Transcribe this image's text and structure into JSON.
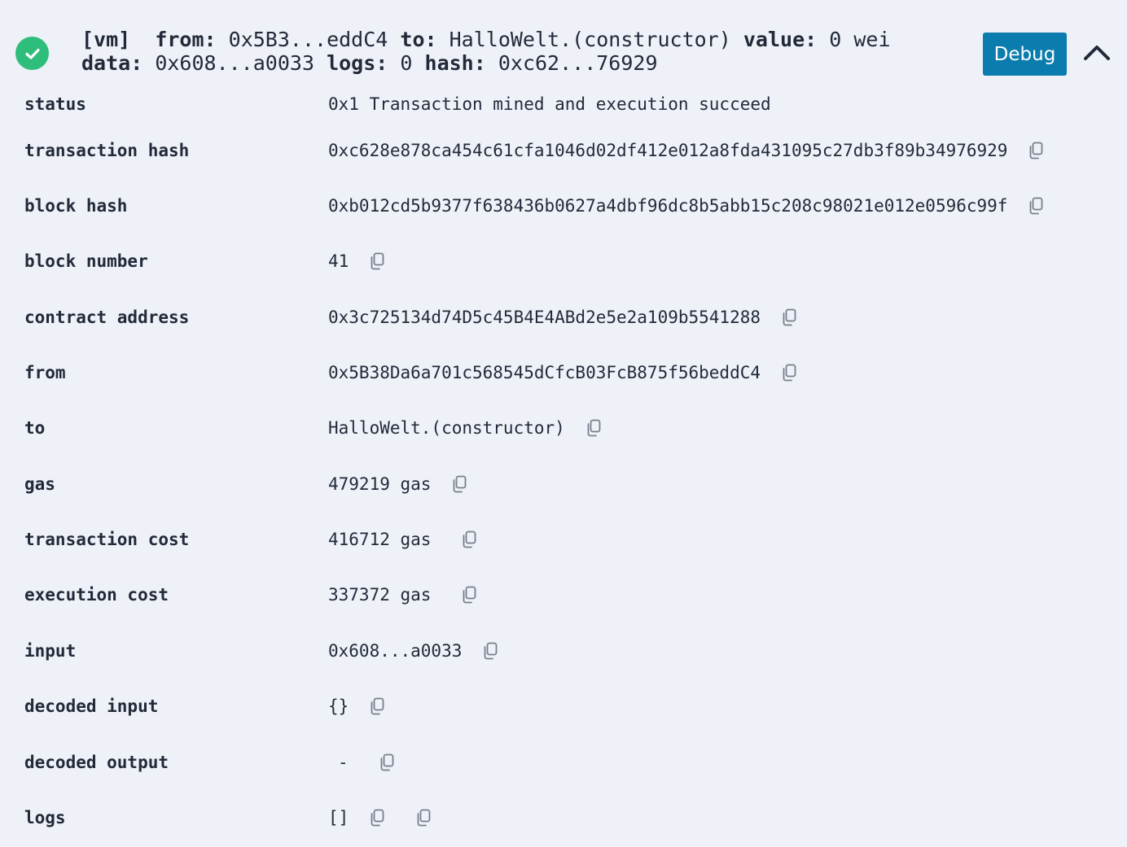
{
  "header": {
    "vm_tag": "[vm]",
    "from_label": "from:",
    "from_value": "0x5B3...eddC4",
    "to_label": "to:",
    "to_value": "HalloWelt.(constructor)",
    "value_label": "value:",
    "value_value": "0 wei",
    "data_label": "data:",
    "data_value": "0x608...a0033",
    "logs_label": "logs:",
    "logs_value": "0",
    "hash_label": "hash:",
    "hash_value": "0xc62...76929",
    "debug_label": "Debug",
    "status_color": "#2fbd7c",
    "debug_color": "#0a7cad"
  },
  "details": {
    "status": {
      "label": "status",
      "value": "0x1 Transaction mined and execution succeed"
    },
    "transaction_hash": {
      "label": "transaction hash",
      "value": "0xc628e878ca454c61cfa1046d02df412e012a8fda431095c27db3f89b34976929"
    },
    "block_hash": {
      "label": "block hash",
      "value": "0xb012cd5b9377f638436b0627a4dbf96dc8b5abb15c208c98021e012e0596c99f"
    },
    "block_number": {
      "label": "block number",
      "value": "41"
    },
    "contract_address": {
      "label": "contract address",
      "value": "0x3c725134d74D5c45B4E4ABd2e5e2a109b5541288"
    },
    "from": {
      "label": "from",
      "value": "0x5B38Da6a701c568545dCfcB03FcB875f56beddC4"
    },
    "to": {
      "label": "to",
      "value": "HalloWelt.(constructor)"
    },
    "gas": {
      "label": "gas",
      "value": "479219 gas"
    },
    "transaction_cost": {
      "label": "transaction cost",
      "value": "416712 gas"
    },
    "execution_cost": {
      "label": "execution cost",
      "value": "337372 gas"
    },
    "input": {
      "label": "input",
      "value": "0x608...a0033"
    },
    "decoded_input": {
      "label": "decoded input",
      "value": "{}"
    },
    "decoded_output": {
      "label": "decoded output",
      "value": "-"
    },
    "logs": {
      "label": "logs",
      "value": "[]"
    }
  }
}
